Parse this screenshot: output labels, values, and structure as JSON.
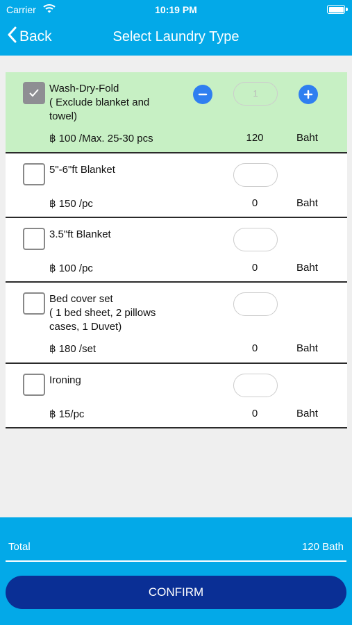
{
  "status_bar": {
    "carrier": "Carrier",
    "time": "10:19 PM"
  },
  "nav": {
    "back_label": "Back",
    "title": "Select Laundry Type"
  },
  "items": [
    {
      "name": "Wash-Dry-Fold\n( Exclude blanket and\ntowel)",
      "price": "฿ 100 /Max. 25-30 pcs",
      "qty": "1",
      "total": "120",
      "unit": "Baht",
      "checked": true
    },
    {
      "name": "5\"-6\"ft Blanket",
      "price": "฿ 150 /pc",
      "qty": "",
      "total": "0",
      "unit": "Baht",
      "checked": false
    },
    {
      "name": "3.5\"ft Blanket",
      "price": "฿ 100 /pc",
      "qty": "",
      "total": "0",
      "unit": "Baht",
      "checked": false
    },
    {
      "name": "Bed cover set\n( 1 bed sheet, 2 pillows\ncases, 1 Duvet)",
      "price": "฿ 180 /set",
      "qty": "",
      "total": "0",
      "unit": "Baht",
      "checked": false
    },
    {
      "name": "Ironing",
      "price": "฿ 15/pc",
      "qty": "",
      "total": "0",
      "unit": "Baht",
      "checked": false
    }
  ],
  "footer": {
    "total_label": "Total",
    "total_amount": "120 Bath",
    "confirm_label": "CONFIRM"
  },
  "colors": {
    "header": "#03a9e8",
    "selected_row": "#c7f0c4",
    "confirm": "#0a2f95",
    "stepper": "#2f7ff0"
  },
  "icons": {
    "back": "chevron-left-icon",
    "check": "checkmark-icon",
    "minus": "minus-icon",
    "plus": "plus-icon",
    "wifi": "wifi-icon",
    "battery": "battery-icon"
  }
}
